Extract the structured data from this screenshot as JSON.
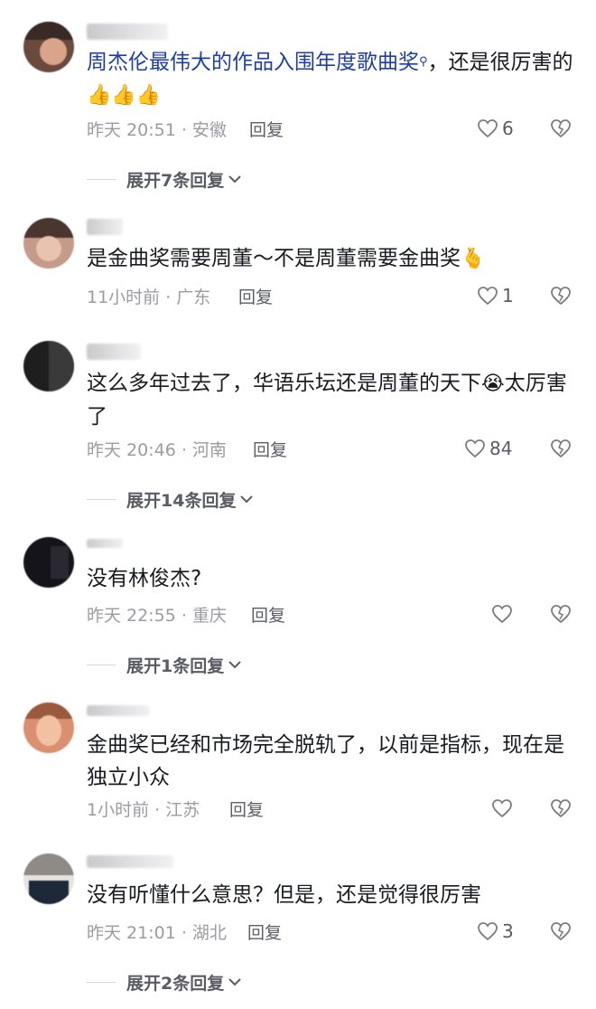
{
  "comments": [
    {
      "text": "周杰伦最伟大的作品入围年度歌曲奖",
      "text_tail": "，还是很厉害的",
      "emojis": "👍👍👍",
      "time": "昨天 20:51 · 安徽",
      "reply_label": "回复",
      "likes": "6",
      "expand_label": "展开7条回复"
    },
    {
      "text": "是金曲奖需要周董～不是周董需要金曲奖",
      "emojis": "🫰",
      "time": "11小时前 · 广东",
      "reply_label": "回复",
      "likes": "1"
    },
    {
      "text": "这么多年过去了，华语乐坛还是周董的天下",
      "emojis": "😭",
      "text_tail": "太厉害了",
      "time": "昨天 20:46 · 河南",
      "reply_label": "回复",
      "likes": "84",
      "expand_label": "展开14条回复"
    },
    {
      "text": "没有林俊杰?",
      "time": "昨天 22:55 · 重庆",
      "reply_label": "回复",
      "likes": "",
      "expand_label": "展开1条回复"
    },
    {
      "text": "金曲奖已经和市场完全脱轨了，以前是指标，现在是独立小众",
      "time": "1小时前 · 江苏",
      "reply_label": "回复",
      "likes": ""
    },
    {
      "text": "没有听懂什么意思？但是，还是觉得很厉害",
      "time": "昨天 21:01 · 湖北",
      "reply_label": "回复",
      "likes": "3",
      "expand_label": "展开2条回复"
    }
  ],
  "icons": {
    "like": "heart-outline-icon",
    "dislike": "broken-heart-icon",
    "expand": "chevron-down-icon",
    "search_hint": "search-icon"
  },
  "colors": {
    "highlight_text": "#1f3ea3",
    "meta_text": "#9b9ba1",
    "body_text": "#1a1b22"
  }
}
